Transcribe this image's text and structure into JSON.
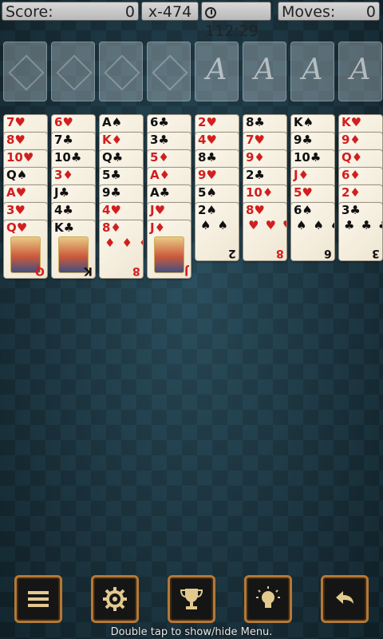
{
  "status": {
    "score_label": "Score:",
    "score_value": "0",
    "multiplier": "x-474",
    "time": "112:29",
    "moves_label": "Moves:",
    "moves_value": "0"
  },
  "foundations": [
    {
      "label": ""
    },
    {
      "label": ""
    },
    {
      "label": ""
    },
    {
      "label": ""
    },
    {
      "label": "A"
    },
    {
      "label": "A"
    },
    {
      "label": "A"
    },
    {
      "label": "A"
    }
  ],
  "columns": [
    [
      "7♥",
      "8♥",
      "10♥",
      "Q♠",
      "A♥",
      "3♥",
      "Q♥"
    ],
    [
      "6♥",
      "7♣",
      "10♣",
      "3♦",
      "J♣",
      "4♣",
      "K♣"
    ],
    [
      "A♠",
      "K♦",
      "Q♣",
      "5♣",
      "9♣",
      "4♥",
      "8♦"
    ],
    [
      "6♣",
      "3♣",
      "5♦",
      "A♦",
      "A♣",
      "J♥",
      "J♦"
    ],
    [
      "2♥",
      "4♥",
      "8♣",
      "9♥",
      "5♠",
      "2♠"
    ],
    [
      "8♣",
      "7♥",
      "9♦",
      "2♣",
      "10♦",
      "8♥"
    ],
    [
      "K♠",
      "9♣",
      "10♣",
      "J♦",
      "5♥",
      "6♠"
    ],
    [
      "K♥",
      "9♦",
      "Q♦",
      "6♦",
      "2♦",
      "3♣"
    ]
  ],
  "menu": {
    "items": [
      "menu",
      "settings",
      "trophy",
      "hint",
      "undo"
    ],
    "hint": "Double tap to show/hide Menu."
  }
}
